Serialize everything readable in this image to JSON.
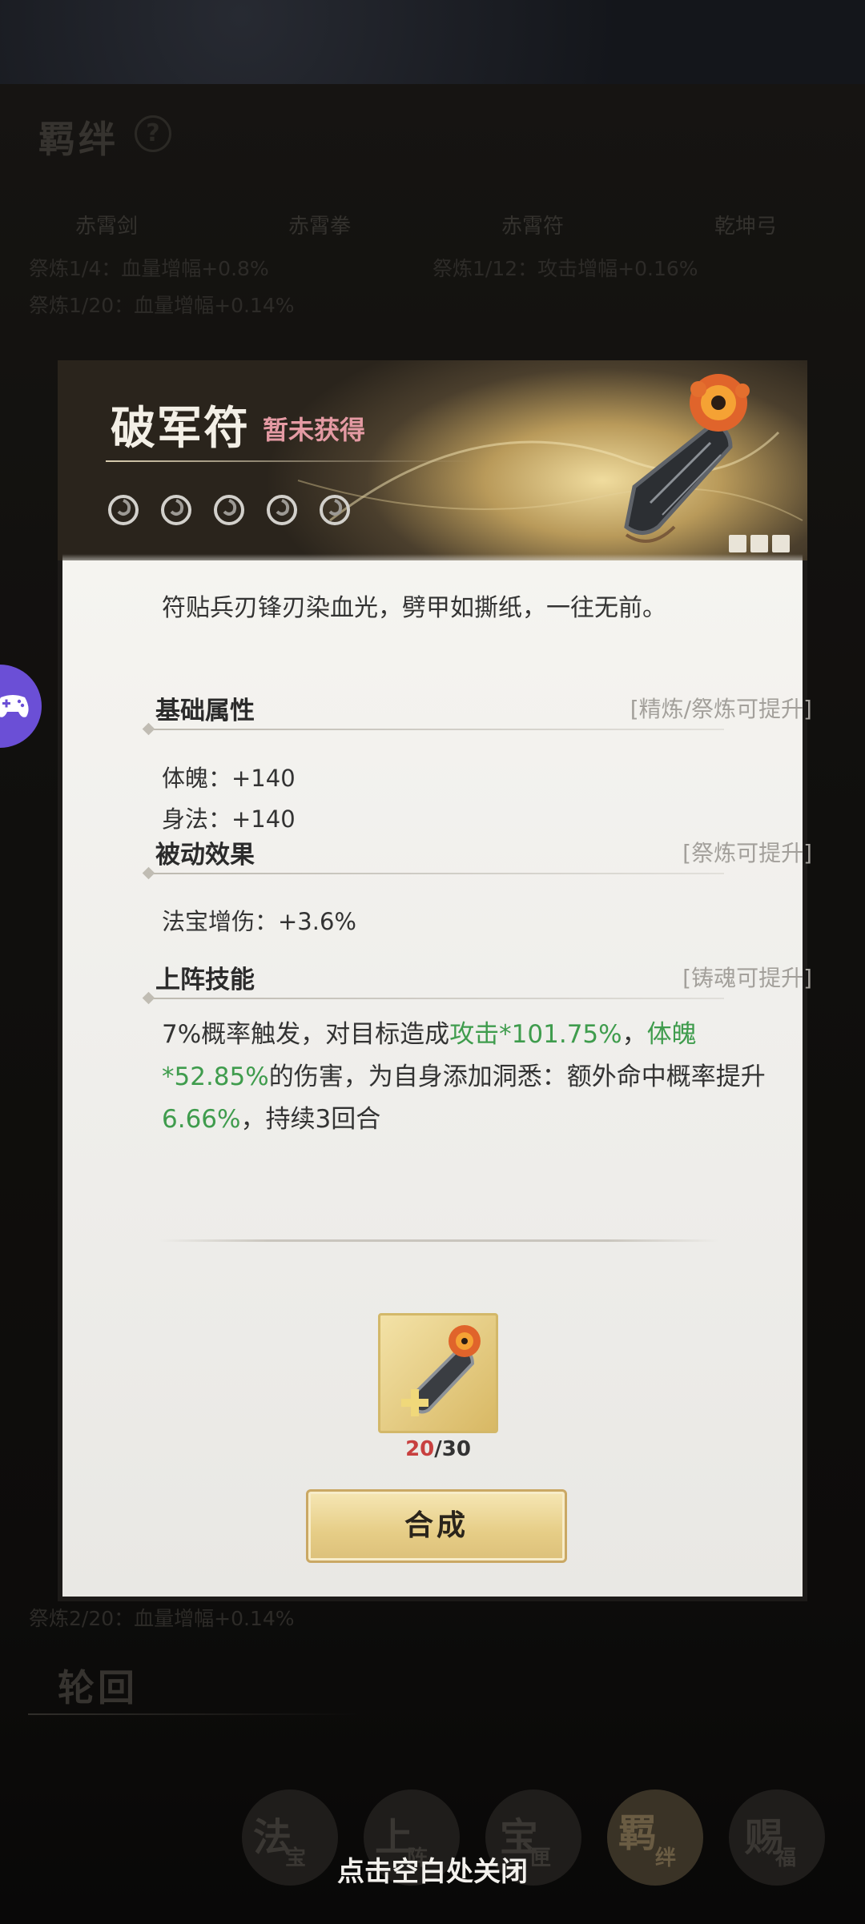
{
  "background": {
    "bond_title": "羁绊",
    "help": "?",
    "tabs": [
      "赤霄剑",
      "赤霄拳",
      "赤霄符",
      "乾坤弓"
    ],
    "bonus_lines_top": [
      "祭炼1/4：血量增幅+0.8%",
      "祭炼1/12：攻击增幅+0.16%",
      "祭炼1/20：血量增幅+0.14%"
    ],
    "bonus_line_bottom": "祭炼2/20：血量增幅+0.14%",
    "section_cycle": "轮回",
    "nav": [
      {
        "big": "法",
        "small": "宝"
      },
      {
        "big": "上",
        "small": "阵"
      },
      {
        "big": "宝",
        "small": "匣"
      },
      {
        "big": "羁",
        "small": "绊"
      },
      {
        "big": "赐",
        "small": "福"
      }
    ]
  },
  "modal": {
    "title": "破军符",
    "status": "暂未获得",
    "stars": 5,
    "description": "符贴兵刃锋刃染血光，劈甲如撕纸，一往无前。",
    "base_attr": {
      "title": "基础属性",
      "hint": "[精炼/祭炼可提升]",
      "items": [
        "体魄：+140",
        "身法：+140"
      ]
    },
    "passive": {
      "title": "被动效果",
      "hint": "[祭炼可提升]",
      "items": [
        "法宝增伤：+3.6%"
      ]
    },
    "skill": {
      "title": "上阵技能",
      "hint": "[铸魂可提升]",
      "text_1": "7%概率触发，对目标造成",
      "hl_1": "攻击*101.75%",
      "text_2": "，",
      "hl_2": "体魄*52.85%",
      "text_3": "的伤害，为自身添加洞悉：额外命中概率提升",
      "hl_3": "6.66%",
      "text_4": "，持续3回合"
    },
    "fragments": {
      "current": "20",
      "total": "/30"
    },
    "craft_label": "合成"
  },
  "close_hint": "点击空白处关闭",
  "colors": {
    "highlight_green": "#3f9c4d",
    "not_owned_pink": "#e49aa3",
    "accent_gold": "#e6cd86"
  }
}
